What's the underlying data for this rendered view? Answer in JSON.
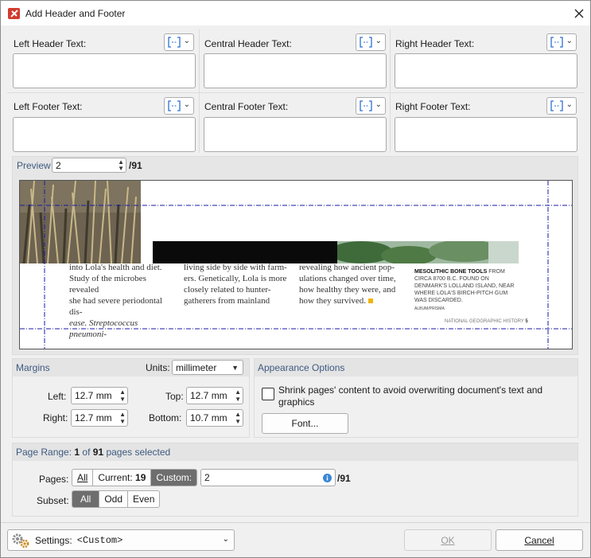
{
  "window": {
    "title": "Add Header and Footer"
  },
  "header": {
    "left_label": "Left Header Text:",
    "center_label": "Central Header Text:",
    "right_label": "Right Header Text:"
  },
  "footer": {
    "left_label": "Left Footer Text:",
    "center_label": "Central Footer Text:",
    "right_label": "Right Footer Text:"
  },
  "preview": {
    "label": "Preview",
    "page_value": "2",
    "page_total": "/91",
    "page_text": {
      "col1": [
        "into Lola's health and diet.",
        "Study of the microbes revealed",
        "she had severe periodontal dis-",
        "ease. Streptococcus pneumoni-"
      ],
      "col2": [
        "living side by side with farm-",
        "ers. Genetically, Lola is more",
        "closely related to hunter-",
        "gatherers from mainland"
      ],
      "col3": [
        "revealing how ancient pop-",
        "ulations changed over time,",
        "how healthy they were, and",
        "how they survived."
      ],
      "caption_bold": "MESOLITHIC BONE TOOLS",
      "caption_rest": " FROM CIRCA 8700 B.C. FOUND ON DENMARK'S LOLLAND ISLAND, NEAR WHERE LOLA'S BIRCH-PITCH GUM WAS DISCARDED.",
      "credit": "ALBUM/PRISMA",
      "folio": "NATIONAL GEOGRAPHIC HISTORY",
      "folio_num": "5"
    }
  },
  "margins": {
    "title": "Margins",
    "units_label": "Units:",
    "units_value": "millimeter",
    "left_label": "Left:",
    "left_value": "12.7 mm",
    "top_label": "Top:",
    "top_value": "12.7 mm",
    "right_label": "Right:",
    "right_value": "12.7 mm",
    "bottom_label": "Bottom:",
    "bottom_value": "10.7 mm"
  },
  "appearance": {
    "title": "Appearance Options",
    "shrink_line1": "Shrink pages' content to avoid overwriting document's text and",
    "shrink_line2": "graphics",
    "font_button": "Font..."
  },
  "page_range": {
    "title_prefix": "Page Range: ",
    "selected": "1",
    "of": " of ",
    "total": "91",
    "suffix": " pages selected",
    "pages_label": "Pages:",
    "all": "All",
    "current_label": "Current:",
    "current_value": "19",
    "custom": "Custom:",
    "custom_value": "2",
    "custom_total": "/91",
    "subset_label": "Subset:",
    "subset_all": "All",
    "subset_odd": "Odd",
    "subset_even": "Even"
  },
  "bottom": {
    "settings_label": "Settings:",
    "settings_value": "<Custom>",
    "ok": "OK",
    "cancel": "Cancel"
  },
  "colors": {
    "accent": "#3d5a80",
    "guide": "#1a1aa8",
    "selected_seg": "#6e6e6e"
  }
}
